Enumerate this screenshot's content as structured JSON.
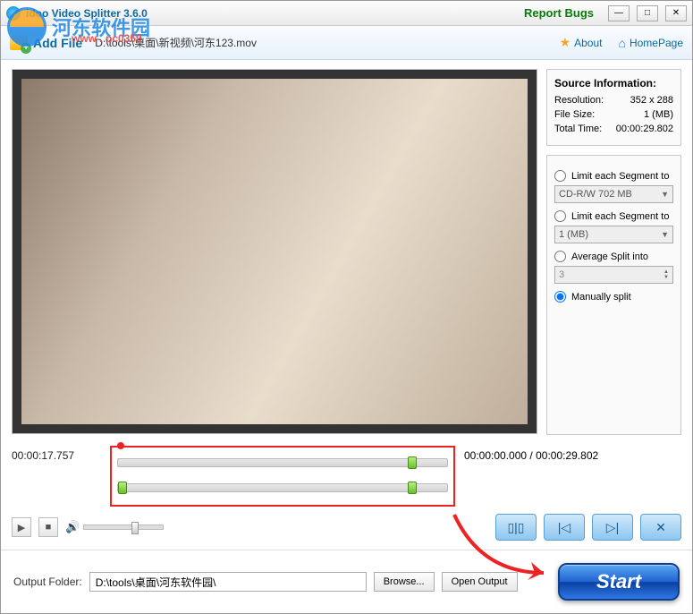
{
  "title": "idoo Video Splitter 3.6.0",
  "report_bugs": "Report Bugs",
  "toolbar": {
    "add_file": "Add File",
    "filepath": "D:\\tools\\桌面\\新视频\\河东123.mov",
    "about": "About",
    "homepage": "HomePage"
  },
  "watermark": {
    "text": "河东软件园",
    "sub": "www . pc0359 ."
  },
  "info": {
    "title": "Source Information:",
    "resolution_label": "Resolution:",
    "resolution_value": "352 x 288",
    "filesize_label": "File Size:",
    "filesize_value": "1 (MB)",
    "totaltime_label": "Total Time:",
    "totaltime_value": "00:00:29.802"
  },
  "options": {
    "opt1_label": "Limit each Segment to",
    "opt1_value": "CD-R/W 702 MB",
    "opt2_label": "Limit each Segment to",
    "opt2_value": "1 (MB)",
    "opt3_label": "Average Split into",
    "opt3_value": "3",
    "opt4_label": "Manually split",
    "selected": "opt4"
  },
  "timeline": {
    "current": "00:00:17.757",
    "range_start": "00:00:00.000",
    "range_end": "00:00:29.802"
  },
  "footer": {
    "label": "Output Folder:",
    "path": "D:\\tools\\桌面\\河东软件园\\",
    "browse": "Browse...",
    "open": "Open Output",
    "start": "Start"
  }
}
